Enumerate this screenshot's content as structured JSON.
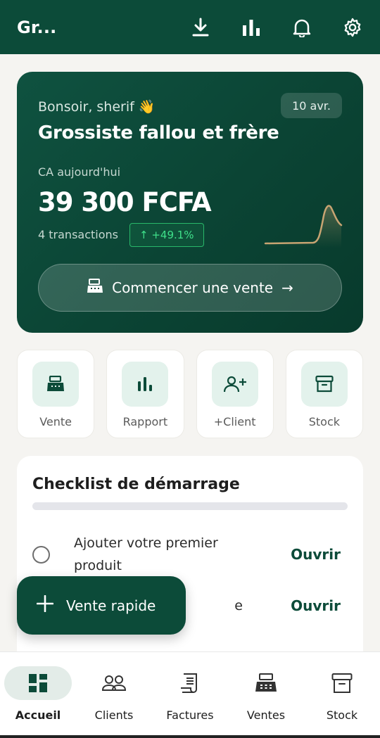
{
  "appbar": {
    "title": "Gr...",
    "icons": [
      "download-icon",
      "bar-chart-icon",
      "bell-icon",
      "gear-icon"
    ]
  },
  "hero": {
    "greeting": "Bonsoir, sherif 👋",
    "date": "10 avr.",
    "business_name": "Grossiste fallou et frère",
    "ca_label": "CA aujourd'hui",
    "amount": "39 300 FCFA",
    "transactions": "4 transactions",
    "growth": "↑ +49.1%",
    "cta_label": "Commencer une vente",
    "cta_arrow": "→",
    "colors": {
      "accent": "#0c4b39",
      "growth": "#3fe08a",
      "sparkline": "#c8a472"
    }
  },
  "quick_actions": [
    {
      "label": "Vente",
      "icon": "register-icon"
    },
    {
      "label": "Rapport",
      "icon": "bar-chart-icon"
    },
    {
      "label": "+Client",
      "icon": "add-user-icon"
    },
    {
      "label": "Stock",
      "icon": "archive-icon"
    }
  ],
  "checklist": {
    "title": "Checklist de démarrage",
    "progress": 0,
    "items": [
      {
        "text": "Ajouter votre premier produit",
        "action": "Ouvrir"
      },
      {
        "text": "e",
        "action": "Ouvrir"
      }
    ]
  },
  "fab": {
    "label": "Vente rapide",
    "icon": "plus-icon"
  },
  "bottom_nav": [
    {
      "label": "Accueil",
      "icon": "dashboard-icon",
      "active": true
    },
    {
      "label": "Clients",
      "icon": "users-icon",
      "active": false
    },
    {
      "label": "Factures",
      "icon": "invoice-icon",
      "active": false
    },
    {
      "label": "Ventes",
      "icon": "register-icon",
      "active": false
    },
    {
      "label": "Stock",
      "icon": "archive-icon",
      "active": false
    }
  ]
}
